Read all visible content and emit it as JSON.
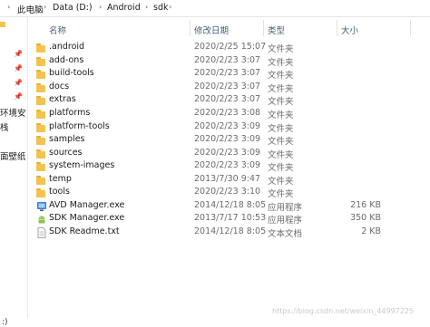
{
  "address_bar": {
    "crumbs": [
      "此电脑",
      "Data (D:)",
      "Android",
      "sdk"
    ]
  },
  "left_pane": {
    "labels": [
      "环境安",
      "栈",
      "面壁纸"
    ],
    "bottom": ":)"
  },
  "columns": {
    "name": "名称",
    "date": "修改日期",
    "type": "类型",
    "size": "大小"
  },
  "files": [
    {
      "name": ".android",
      "date": "2020/2/25 15:07",
      "type": "文件夹",
      "size": "",
      "icon": "folder-icon"
    },
    {
      "name": "add-ons",
      "date": "2020/2/23 3:07",
      "type": "文件夹",
      "size": "",
      "icon": "folder-icon"
    },
    {
      "name": "build-tools",
      "date": "2020/2/23 3:07",
      "type": "文件夹",
      "size": "",
      "icon": "folder-icon"
    },
    {
      "name": "docs",
      "date": "2020/2/23 3:07",
      "type": "文件夹",
      "size": "",
      "icon": "folder-icon"
    },
    {
      "name": "extras",
      "date": "2020/2/23 3:07",
      "type": "文件夹",
      "size": "",
      "icon": "folder-icon"
    },
    {
      "name": "platforms",
      "date": "2020/2/23 3:08",
      "type": "文件夹",
      "size": "",
      "icon": "folder-icon"
    },
    {
      "name": "platform-tools",
      "date": "2020/2/23 3:09",
      "type": "文件夹",
      "size": "",
      "icon": "folder-icon"
    },
    {
      "name": "samples",
      "date": "2020/2/23 3:09",
      "type": "文件夹",
      "size": "",
      "icon": "folder-icon"
    },
    {
      "name": "sources",
      "date": "2020/2/23 3:09",
      "type": "文件夹",
      "size": "",
      "icon": "folder-icon"
    },
    {
      "name": "system-images",
      "date": "2020/2/23 3:09",
      "type": "文件夹",
      "size": "",
      "icon": "folder-icon"
    },
    {
      "name": "temp",
      "date": "2013/7/30 9:47",
      "type": "文件夹",
      "size": "",
      "icon": "folder-icon"
    },
    {
      "name": "tools",
      "date": "2020/2/23 3:10",
      "type": "文件夹",
      "size": "",
      "icon": "folder-icon"
    },
    {
      "name": "AVD Manager.exe",
      "date": "2014/12/18 8:05",
      "type": "应用程序",
      "size": "216 KB",
      "icon": "avd-app-icon"
    },
    {
      "name": "SDK Manager.exe",
      "date": "2013/7/17 10:53",
      "type": "应用程序",
      "size": "350 KB",
      "icon": "android-app-icon"
    },
    {
      "name": "SDK Readme.txt",
      "date": "2014/12/18 8:05",
      "type": "文本文档",
      "size": "2 KB",
      "icon": "text-file-icon"
    }
  ],
  "watermark": "https://blog.csdn.net/weixin_44997225"
}
